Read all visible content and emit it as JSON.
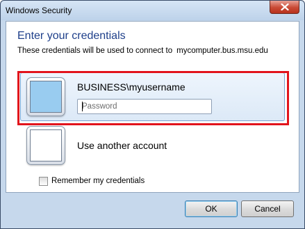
{
  "window": {
    "title": "Windows Security",
    "close_icon": "close-x-icon"
  },
  "dialog": {
    "heading": "Enter your credentials",
    "subtext": "These credentials will be used to connect to",
    "host": "mycomputer.bus.msu.edu"
  },
  "credential_tile": {
    "username": "BUSINESS\\myusername",
    "password_placeholder": "Password",
    "password_value": "",
    "avatar_color": "#99ccf0"
  },
  "other_account": {
    "label": "Use another account",
    "avatar_color": "#ffffff"
  },
  "remember": {
    "label": "Remember my credentials",
    "checked": false
  },
  "buttons": {
    "ok": "OK",
    "cancel": "Cancel"
  },
  "colors": {
    "heading": "#1e3f8a",
    "highlight_border": "#e2141c",
    "frame": "#c6d8ec"
  }
}
